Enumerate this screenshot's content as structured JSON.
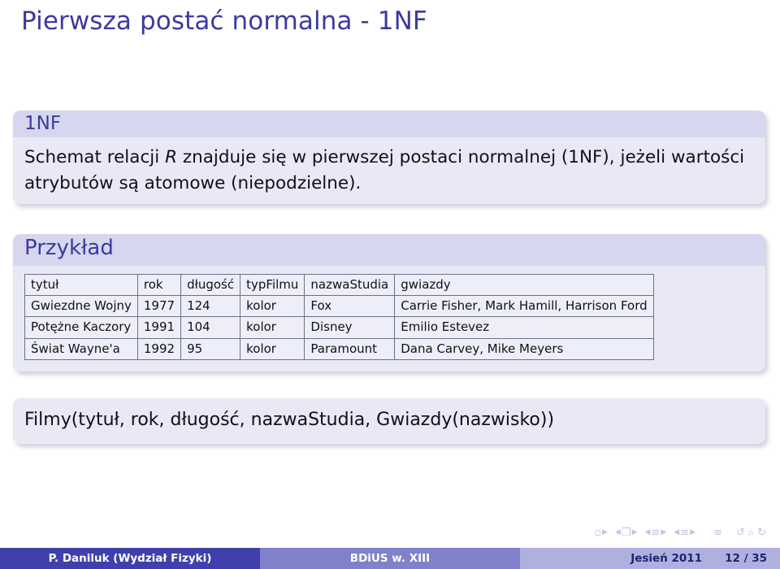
{
  "slide": {
    "title": "Pierwsza postać normalna - 1NF",
    "accent_color": "#3b3b9e",
    "block_title_bg": "#d6d6ee",
    "block_body_bg": "#e9e9f6"
  },
  "definition_block": {
    "title": "1NF",
    "text_before_italic": "Schemat relacji ",
    "italic_symbol": "R",
    "text_after_italic": " znajduje się w pierwszej postaci normalnej (1NF), jeżeli wartości atrybutów są atomowe (niepodzielne)."
  },
  "example_block": {
    "title": "Przykład",
    "table": {
      "headers": [
        "tytuł",
        "rok",
        "długość",
        "typFilmu",
        "nazwaStudia",
        "gwiazdy"
      ],
      "rows": [
        [
          "Gwiezdne Wojny",
          "1977",
          "124",
          "kolor",
          "Fox",
          "Carrie Fisher, Mark Hamill, Harrison Ford"
        ],
        [
          "Potężne Kaczory",
          "1991",
          "104",
          "kolor",
          "Disney",
          "Emilio Estevez"
        ],
        [
          "Świat Wayne'a",
          "1992",
          "95",
          "kolor",
          "Paramount",
          "Dana Carvey, Mike Meyers"
        ]
      ]
    }
  },
  "schema_block": {
    "text": "Filmy(tytuł, rok, długość, nazwaStudia, Gwiazdy(nazwisko))"
  },
  "navigation_symbols": {
    "slide_prev": "◀",
    "slide_icon": "▫",
    "slide_next": "▶",
    "frame_prev": "◀",
    "frame_icon": "❐",
    "frame_next": "▶",
    "subsection_prev": "◀",
    "subsection_icon": "≡",
    "subsection_next": "▶",
    "section_prev": "◀",
    "section_icon": "≡",
    "section_next": "▶",
    "doc_icon": "≡",
    "back_icon": "↺",
    "search_icon": "⌕",
    "forward_icon": "↻",
    "color": "#c3c3e2"
  },
  "footer": {
    "author": "P. Daniluk  (Wydział Fizyki)",
    "course": "BDiUS w. XIII",
    "date": "Jesień 2011",
    "page": "12 / 35",
    "left_bg": "#4040ad",
    "mid_bg": "#8080cb",
    "right_bg": "#b0b0e0"
  }
}
